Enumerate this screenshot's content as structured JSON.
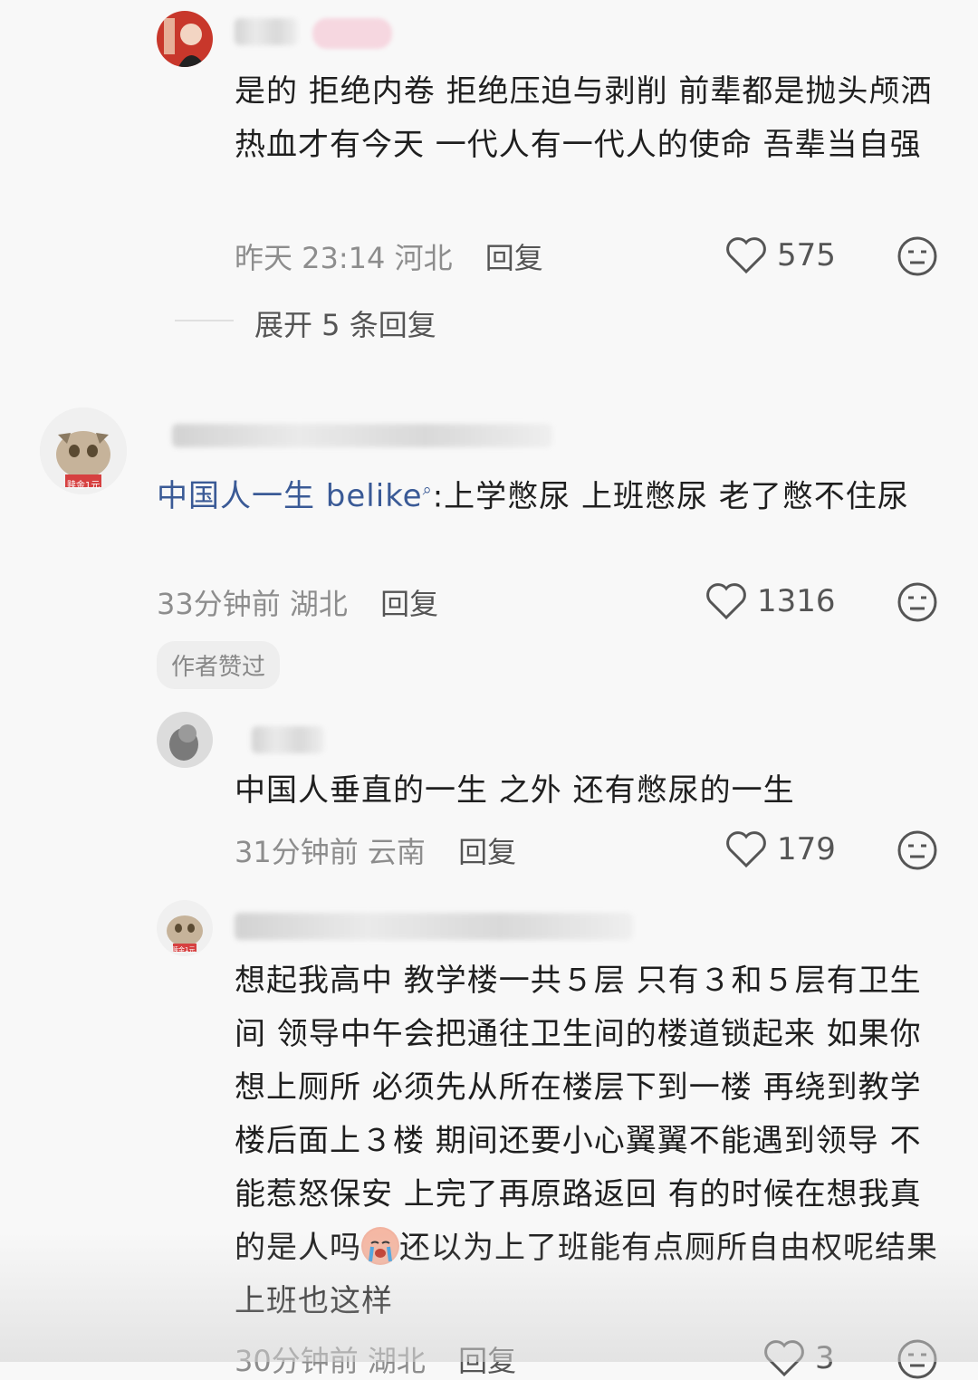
{
  "comments": [
    {
      "text": "是的 拒绝内卷 拒绝压迫与剥削 前辈都是抛头颅洒热血才有今天 一代人有一代人的使命 吾辈当自强",
      "time": "昨天 23:14",
      "location": "河北",
      "reply_label": "回复",
      "likes": "575",
      "expand_label": "展开 5 条回复"
    },
    {
      "topic": "中国人一生 belike",
      "topic_icon": "search-icon",
      "text": ":上学憋尿 上班憋尿 老了憋不住尿",
      "time": "33分钟前",
      "location": "湖北",
      "reply_label": "回复",
      "likes": "1316",
      "author_tag": "作者赞过",
      "avatar_badge": "赎金1元"
    },
    {
      "text": "中国人垂直的一生 之外 还有憋尿的一生",
      "time": "31分钟前",
      "location": "云南",
      "reply_label": "回复",
      "likes": "179"
    },
    {
      "text_part1": "想起我高中 教学楼一共５层 只有３和５层有卫生间 领导中午会把通往卫生间的楼道锁起来 如果你想上厕所 必须先从所在楼层下到一楼 再绕到教学楼后面上３楼 期间还要小心翼翼不能遇到领导 不能惹怒保安 上完了再原路返回 有的时候在想我真的是人吗",
      "emoji": "crying-face-emoji",
      "text_part2": "还以为上了班能有点厕所自由权呢结果上班也这样",
      "time": "30分钟前",
      "location": "湖北",
      "reply_label": "回复",
      "likes": "3",
      "avatar_badge": "赎金1元"
    }
  ],
  "colors": {
    "background": "#f8f8f8",
    "topic_link": "#3a5a96",
    "meta_gray": "#8d8d8d"
  }
}
